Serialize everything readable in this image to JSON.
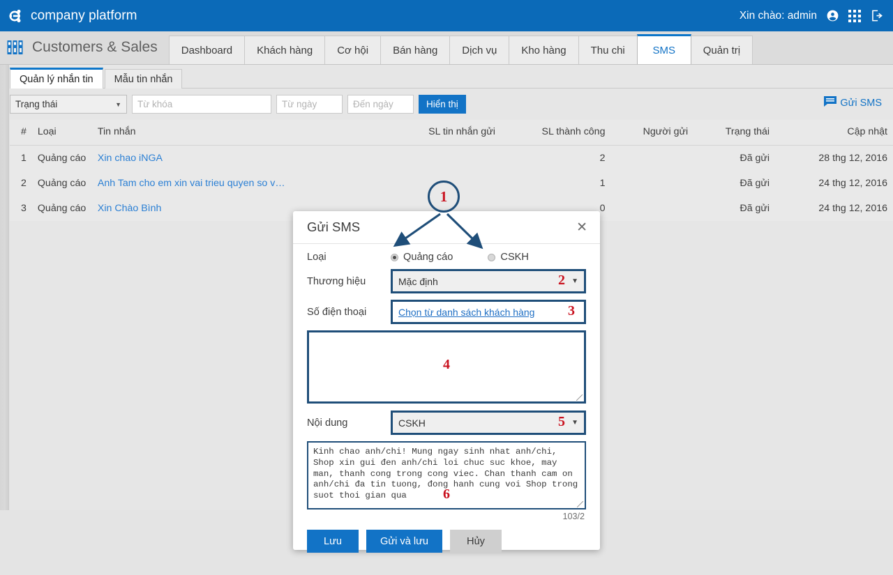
{
  "header": {
    "brand": "company platform",
    "greeting": "Xin chào: admin",
    "icons": [
      "account-circle-icon",
      "apps-grid-icon",
      "logout-icon"
    ]
  },
  "module": {
    "title": "Customers & Sales",
    "icon": "modules-grid-icon"
  },
  "main_tabs": [
    {
      "label": "Dashboard",
      "active": false
    },
    {
      "label": "Khách hàng",
      "active": false
    },
    {
      "label": "Cơ hội",
      "active": false
    },
    {
      "label": "Bán hàng",
      "active": false
    },
    {
      "label": "Dịch vụ",
      "active": false
    },
    {
      "label": "Kho hàng",
      "active": false
    },
    {
      "label": "Thu chi",
      "active": false
    },
    {
      "label": "SMS",
      "active": true
    },
    {
      "label": "Quản trị",
      "active": false
    }
  ],
  "sub_tabs": [
    {
      "label": "Quản lý nhắn tin",
      "active": true
    },
    {
      "label": "Mẫu tin nhắn",
      "active": false
    }
  ],
  "filters": {
    "status_select": "Trạng thái",
    "keyword_placeholder": "Từ khóa",
    "from_date_placeholder": "Từ ngày",
    "to_date_placeholder": "Đến ngày",
    "show_button": "Hiển thị",
    "send_sms_link": "Gửi SMS"
  },
  "table": {
    "columns": [
      "#",
      "Loại",
      "Tin nhắn",
      "SL tin nhắn gửi",
      "SL thành công",
      "Người gửi",
      "Trạng thái",
      "Cập nhật"
    ],
    "rows": [
      {
        "num": "1",
        "loai": "Quảng cáo",
        "tin_nhan": "Xin chao iNGA",
        "sl_gui": "",
        "sl_thanh_cong": "2",
        "nguoi_gui": "",
        "trang_thai": "Đã gửi",
        "cap_nhat": "28 thg 12, 2016"
      },
      {
        "num": "2",
        "loai": "Quảng cáo",
        "tin_nhan": "Anh Tam cho em xin vai trieu quyen so ve n",
        "sl_gui": "",
        "sl_thanh_cong": "1",
        "nguoi_gui": "",
        "trang_thai": "Đã gửi",
        "cap_nhat": "24 thg 12, 2016"
      },
      {
        "num": "3",
        "loai": "Quảng cáo",
        "tin_nhan": "Xin Chào Bình",
        "sl_gui": "",
        "sl_thanh_cong": "0",
        "nguoi_gui": "",
        "trang_thai": "Đã gửi",
        "cap_nhat": "24 thg 12, 2016"
      }
    ]
  },
  "modal": {
    "title": "Gửi SMS",
    "close_icon": "close-icon",
    "labels": {
      "loai": "Loại",
      "thuong_hieu": "Thương hiệu",
      "so_dien_thoai": "Số điện thoại",
      "noi_dung": "Nội dung"
    },
    "radio_options": [
      {
        "label": "Quảng cáo",
        "selected": true
      },
      {
        "label": "CSKH",
        "selected": false
      }
    ],
    "brand_value": "Mặc định",
    "phone_link": "Chọn từ danh sách khách hàng",
    "recipients_value": "",
    "template_value": "CSKH",
    "message_body": "Kinh chao anh/chi! Mung ngay sinh nhat anh/chi, Shop xin gui đen anh/chi loi chuc suc khoe, may man, thanh cong trong cong viec. Chan thanh cam on anh/chi đa tin tuong, đong hanh cung voi Shop trong suot thoi gian qua",
    "counter": "103/2",
    "buttons": {
      "save": "Lưu",
      "send_and_save": "Gửi và lưu",
      "cancel": "Hủy"
    }
  },
  "annotations": {
    "a1": "1",
    "a2": "2",
    "a3": "3",
    "a4": "4",
    "a5": "5",
    "a6": "6",
    "highlight_color": "#1f4e79",
    "number_color": "#c9121f"
  },
  "colors": {
    "brand_blue": "#0b6ab8",
    "accent_blue": "#1273c6",
    "link_blue": "#2a7fd4",
    "page_bg": "#e4e4e4"
  }
}
